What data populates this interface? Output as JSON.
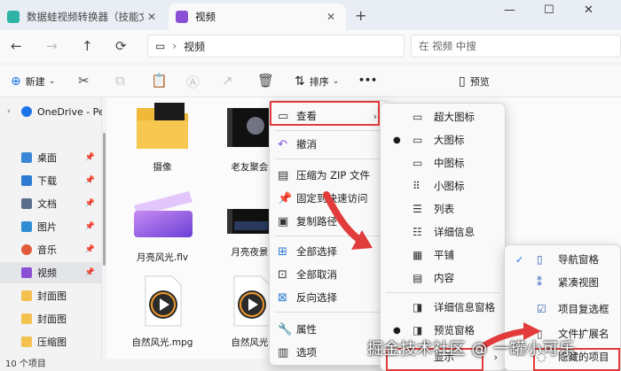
{
  "tabs": [
    {
      "title": "数据蛙视频转换器（技能文",
      "active": false
    },
    {
      "title": "视频",
      "active": true
    }
  ],
  "window": {
    "new_tab": "+",
    "minimize": "—",
    "maximize": "☐",
    "close": "✕"
  },
  "address": {
    "path": "视频",
    "search_placeholder": "在 视频 中搜"
  },
  "toolbar": {
    "new_label": "新建",
    "sort_label": "排序",
    "more_label": "•••",
    "preview_label": "预览"
  },
  "sidebar": {
    "items": [
      {
        "label": "OneDrive - Per",
        "pinned": false,
        "color": "#1a73e8"
      },
      {
        "label": "桌面",
        "pinned": true,
        "color": "#3a86d9"
      },
      {
        "label": "下载",
        "pinned": true,
        "color": "#2d7bd3"
      },
      {
        "label": "文档",
        "pinned": true,
        "color": "#5a6f8c"
      },
      {
        "label": "图片",
        "pinned": true,
        "color": "#2f8dd6"
      },
      {
        "label": "音乐",
        "pinned": true,
        "color": "#e25a3b"
      },
      {
        "label": "视频",
        "pinned": true,
        "color": "#8b4fd6",
        "selected": true
      },
      {
        "label": "封面图",
        "pinned": false,
        "color": "#f2c14e"
      },
      {
        "label": "封面图",
        "pinned": false,
        "color": "#f2c14e"
      },
      {
        "label": "压缩图",
        "pinned": false,
        "color": "#f2c14e"
      }
    ]
  },
  "files": [
    {
      "name": "摄像",
      "kind": "folder"
    },
    {
      "name": "老友聚会.",
      "kind": "video"
    },
    {
      "name": "月亮风光.flv",
      "kind": "clapper"
    },
    {
      "name": "月亮夜景.",
      "kind": "video"
    },
    {
      "name": "自然风光.mpg",
      "kind": "media"
    },
    {
      "name": "自然风光.",
      "kind": "media"
    }
  ],
  "status": {
    "count": "10 个项目"
  },
  "context_menu": {
    "items": [
      {
        "label": "查看",
        "icon": "view-icon",
        "submenu": true
      },
      {
        "label": "撤消",
        "icon": "undo-icon"
      },
      {
        "label": "压缩为 ZIP 文件",
        "icon": "zip-icon"
      },
      {
        "label": "固定到快速访问",
        "icon": "pin-icon"
      },
      {
        "label": "复制路径",
        "icon": "copy-path-icon"
      },
      {
        "label": "全部选择",
        "icon": "select-all-icon"
      },
      {
        "label": "全部取消",
        "icon": "select-none-icon"
      },
      {
        "label": "反向选择",
        "icon": "invert-selection-icon"
      },
      {
        "label": "属性",
        "icon": "properties-icon"
      },
      {
        "label": "选项",
        "icon": "options-icon"
      }
    ]
  },
  "view_submenu": {
    "items": [
      {
        "label": "超大图标",
        "selected": false
      },
      {
        "label": "大图标",
        "selected": true
      },
      {
        "label": "中图标",
        "selected": false
      },
      {
        "label": "小图标",
        "selected": false
      },
      {
        "label": "列表",
        "selected": false
      },
      {
        "label": "详细信息",
        "selected": false
      },
      {
        "label": "平铺",
        "selected": false
      },
      {
        "label": "内容",
        "selected": false
      },
      {
        "label": "详细信息窗格",
        "selected": false
      },
      {
        "label": "预览窗格",
        "selected": true
      },
      {
        "label": "显示",
        "selected": false,
        "submenu": true
      }
    ]
  },
  "show_submenu": {
    "items": [
      {
        "label": "导航窗格",
        "checked": true
      },
      {
        "label": "紧凑视图",
        "checked": false
      },
      {
        "label": "项目复选框",
        "checked": false
      },
      {
        "label": "文件扩展名",
        "checked": false
      },
      {
        "label": "隐藏的项目",
        "checked": false
      }
    ]
  },
  "watermark": "掘金技术社区 @ 一罐小可乐"
}
